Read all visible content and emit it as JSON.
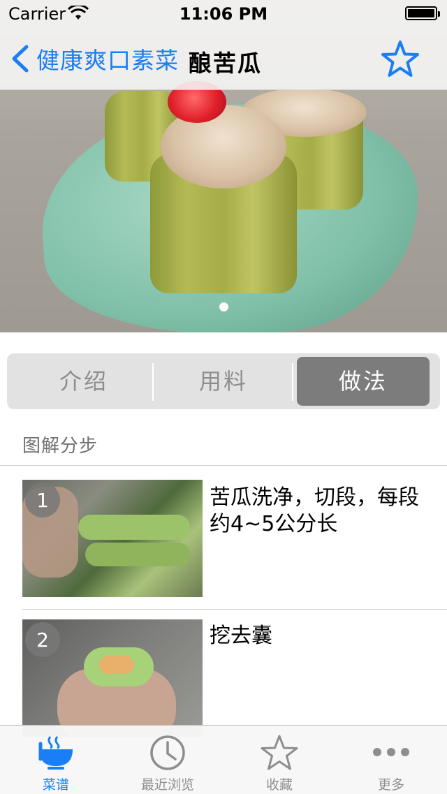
{
  "status_bar": {
    "carrier": "Carrier",
    "time": "11:06 PM"
  },
  "nav": {
    "back_label": "健康爽口素菜",
    "title": "酿苦瓜",
    "favorite_icon": "star-outline-icon"
  },
  "hero": {
    "page_index": 1,
    "page_count": 1
  },
  "segments": {
    "items": [
      {
        "label": "介绍",
        "selected": false
      },
      {
        "label": "用料",
        "selected": false
      },
      {
        "label": "做法",
        "selected": true
      }
    ]
  },
  "steps_section": {
    "header": "图解分步",
    "steps": [
      {
        "number": "1",
        "text": "苦瓜洗净，切段，每段约4~5公分长"
      },
      {
        "number": "2",
        "text": "挖去囊"
      }
    ]
  },
  "tabbar": {
    "items": [
      {
        "label": "菜谱",
        "icon": "bowl-icon",
        "active": true
      },
      {
        "label": "最近浏览",
        "icon": "clock-icon",
        "active": false
      },
      {
        "label": "收藏",
        "icon": "star-icon",
        "active": false
      },
      {
        "label": "更多",
        "icon": "more-dots-icon",
        "active": false
      }
    ]
  },
  "colors": {
    "accent": "#1a7ef5",
    "segment_selected": "#7c7c7c",
    "segment_bg": "#e2e2e2"
  }
}
